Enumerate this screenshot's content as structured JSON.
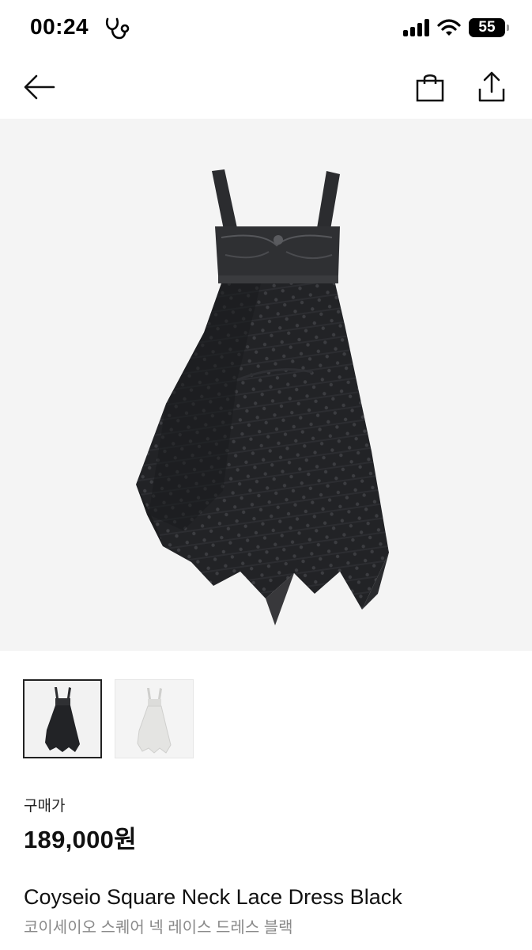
{
  "status_bar": {
    "time": "00:24",
    "battery": "55",
    "battery_level": 0.55,
    "icons": [
      "health-stethoscope-icon",
      "cellular-signal-icon",
      "wifi-icon",
      "battery-icon"
    ]
  },
  "nav": {
    "icons": [
      "back-arrow-icon",
      "shopping-bag-icon",
      "share-icon"
    ]
  },
  "gallery": {
    "thumbnails": [
      "black-dress-thumbnail",
      "white-dress-thumbnail"
    ],
    "selected_index": 0
  },
  "product": {
    "price_label": "구매가",
    "price": "189,000원",
    "name": "Coyseio Square Neck Lace Dress Black",
    "name_ko": "코이세이오 스퀘어 넥 레이스 드레스 블랙"
  },
  "colors": {
    "background": "#ffffff",
    "image_background": "#f4f4f4",
    "text_primary": "#111111",
    "text_secondary": "#8a8a8a",
    "dress_black": "#1e1f21",
    "dress_white": "#e4e4e2"
  }
}
